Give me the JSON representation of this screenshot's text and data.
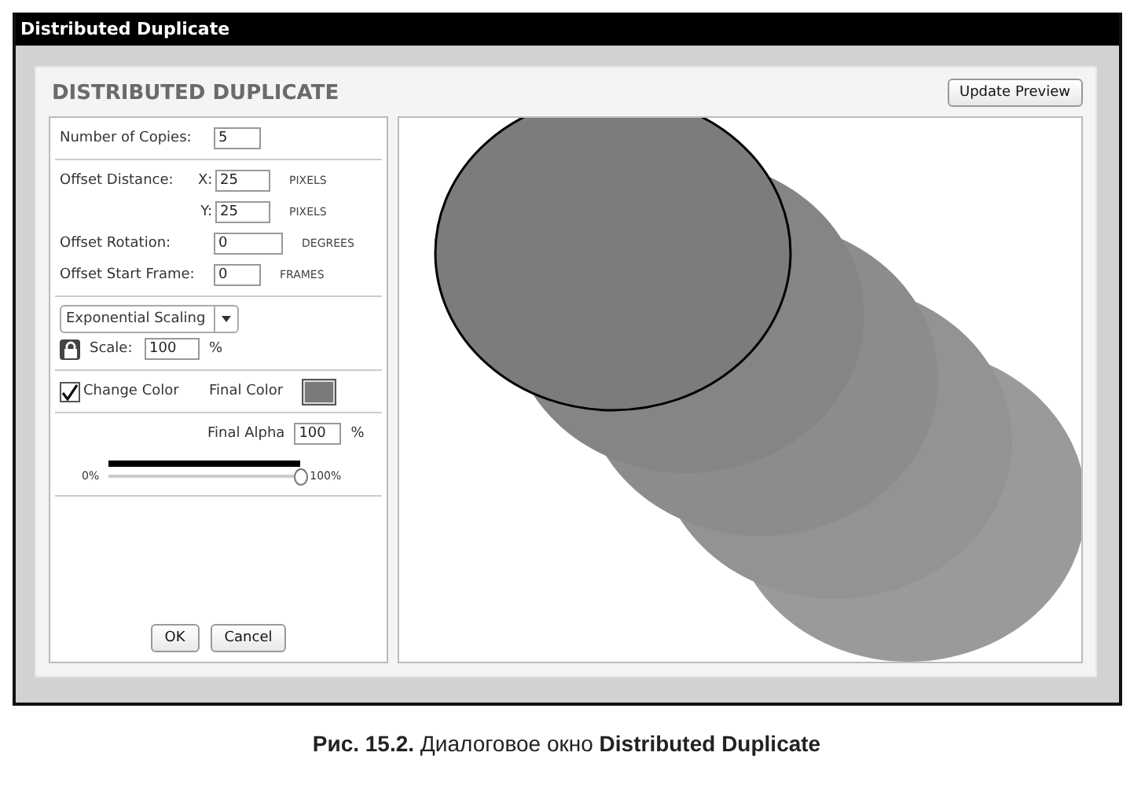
{
  "window": {
    "title": "Distributed Duplicate"
  },
  "dialog": {
    "heading": "DISTRIBUTED DUPLICATE",
    "update_button": "Update Preview"
  },
  "copies": {
    "label": "Number of Copies:",
    "value": "5"
  },
  "offset_distance": {
    "label": "Offset Distance:",
    "x_label": "X:",
    "x_value": "25",
    "x_unit": "PIXELS",
    "y_label": "Y:",
    "y_value": "25",
    "y_unit": "PIXELS"
  },
  "offset_rotation": {
    "label": "Offset Rotation:",
    "value": "0",
    "unit": "DEGREES"
  },
  "offset_start_frame": {
    "label": "Offset Start Frame:",
    "value": "0",
    "unit": "FRAMES"
  },
  "scaling": {
    "dropdown": "Exponential Scaling",
    "locked": true,
    "label": "Scale:",
    "value": "100",
    "unit": "%"
  },
  "color": {
    "checkbox_label": "Change Color",
    "checked": true,
    "final_color_label": "Final Color"
  },
  "alpha": {
    "label": "Final Alpha",
    "value": "100",
    "unit": "%",
    "min_label": "0%",
    "max_label": "100%",
    "level": 1
  },
  "buttons": [
    {
      "label": "OK"
    },
    {
      "label": "Cancel"
    }
  ],
  "caption": "**Рис. 15.2.** Диалоговое окно **Distributed Duplicate**"
}
